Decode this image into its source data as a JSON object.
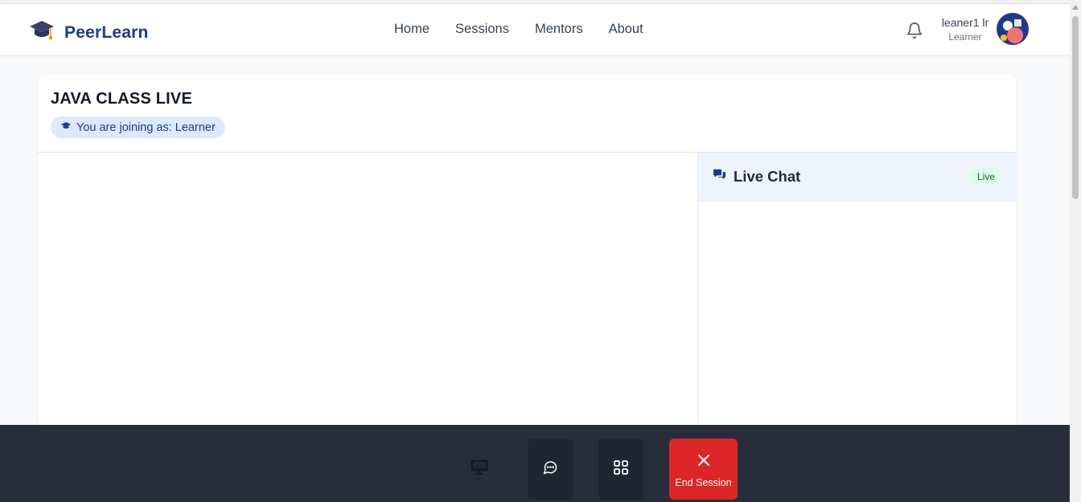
{
  "app": {
    "brand_name": "PeerLearn"
  },
  "nav": {
    "links": [
      "Home",
      "Sessions",
      "Mentors",
      "About"
    ]
  },
  "user": {
    "name": "leaner1 lr",
    "role": "Learner"
  },
  "session": {
    "title": "JAVA CLASS LIVE",
    "join_badge": "You are joining as: Learner"
  },
  "chat": {
    "title": "Live Chat",
    "status_badge": "Live"
  },
  "controls": {
    "end_session_label": "End Session"
  },
  "colors": {
    "brand": "#1e3a8a",
    "control_bar": "#272e3b",
    "danger": "#dc2626",
    "chat_header": "#eef5fe",
    "live_badge": "#dcfce7"
  },
  "icons": [
    "graduation-cap-icon",
    "bell-icon",
    "comments-icon",
    "monitor-icon",
    "chat-bubble-icon",
    "grid-icon",
    "close-icon"
  ]
}
